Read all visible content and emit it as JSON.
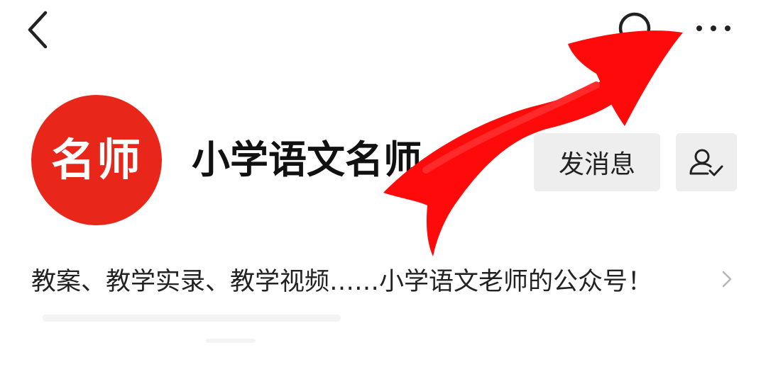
{
  "header": {
    "back_icon": "chevron-left-icon",
    "search_icon": "search-icon",
    "more_icon": "more-horizontal-icon"
  },
  "profile": {
    "avatar_text": "名师",
    "name": "小学语文名师",
    "message_button": "发消息",
    "follow_icon": "user-check-icon",
    "intro": "教案、教学实录、教学视频……小学语文老师的公众号！"
  },
  "colors": {
    "avatar_bg": "#e8261a",
    "annotation_red": "#ff0a0a",
    "button_bg": "#eeeeee"
  }
}
